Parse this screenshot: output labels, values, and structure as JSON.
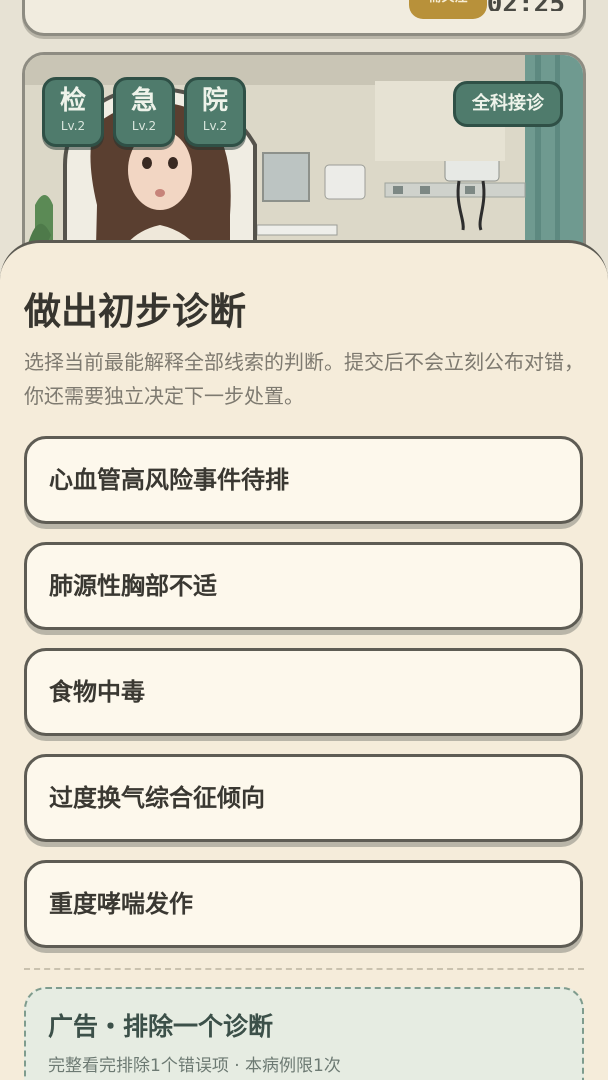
{
  "top_card": {
    "pill_label": "需关注",
    "time": "02:25"
  },
  "scene": {
    "depts": [
      {
        "char": "检",
        "level": "Lv.2"
      },
      {
        "char": "急",
        "level": "Lv.2"
      },
      {
        "char": "院",
        "level": "Lv.2"
      }
    ],
    "accept_label": "全科接诊"
  },
  "sheet": {
    "title": "做出初步诊断",
    "description": "选择当前最能解释全部线索的判断。提交后不会立刻公布对错，你还需要独立决定下一步处置。",
    "options": [
      {
        "label": "心血管高风险事件待排"
      },
      {
        "label": "肺源性胸部不适"
      },
      {
        "label": "食物中毒"
      },
      {
        "label": "过度换气综合征倾向"
      },
      {
        "label": "重度哮喘发作"
      }
    ],
    "ad": {
      "title": "广告・排除一个诊断",
      "subtitle": "完整看完排除1个错误项 · 本病例限1次"
    }
  },
  "colors": {
    "accent_green": "#4f7b6c",
    "sheet_bg": "#f5ecda",
    "option_bg": "#fdf8ec",
    "pill_gold": "#b8913a"
  }
}
